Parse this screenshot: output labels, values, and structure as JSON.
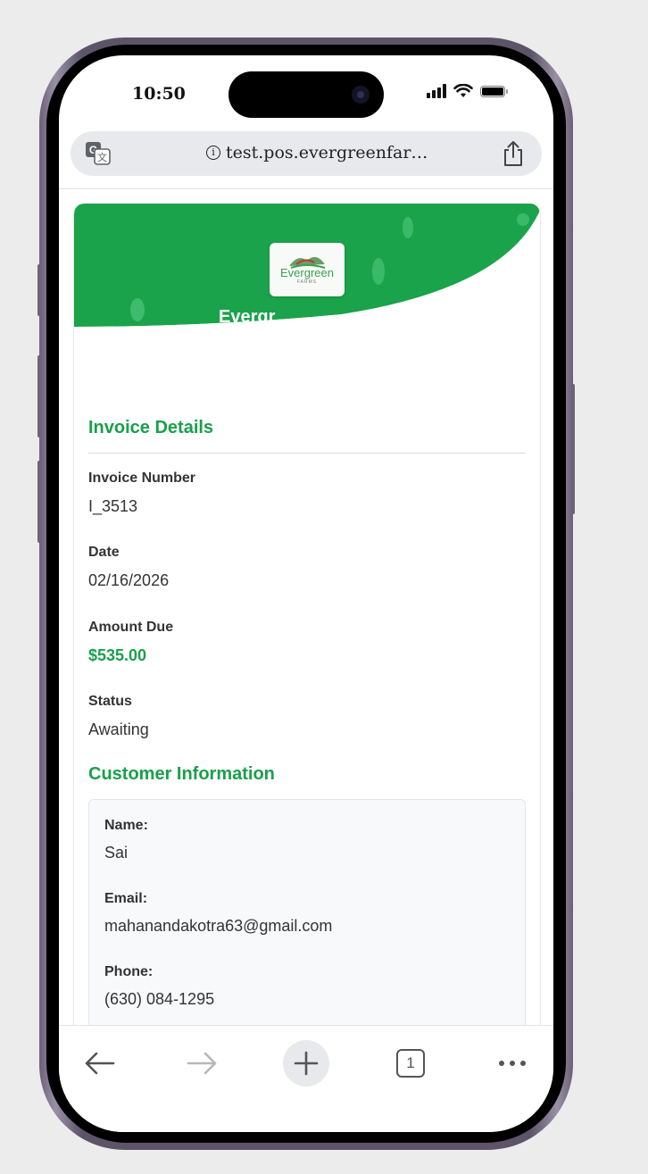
{
  "status_bar": {
    "time": "10:50"
  },
  "browser": {
    "url": "test.pos.evergreenfar…"
  },
  "hero": {
    "logo_text": "Evergreen",
    "logo_sub": "FARMS",
    "title_partial": "Evergr",
    "bg_color": "#1aa34a"
  },
  "invoice": {
    "heading": "Invoice Details",
    "number_label": "Invoice Number",
    "number_value": "I_3513",
    "date_label": "Date",
    "date_value": "02/16/2026",
    "amount_label": "Amount Due",
    "amount_value": "$535.00",
    "status_label": "Status",
    "status_value": "Awaiting"
  },
  "customer": {
    "heading": "Customer Information",
    "name_label": "Name:",
    "name_value": "Sai",
    "email_label": "Email:",
    "email_value": "mahanandakotra63@gmail.com",
    "phone_label": "Phone:",
    "phone_value": "(630) 084-1295"
  },
  "toolbar": {
    "tab_count": "1"
  },
  "colors": {
    "accent": "#1a9f4a",
    "frame": "#5d5468"
  }
}
